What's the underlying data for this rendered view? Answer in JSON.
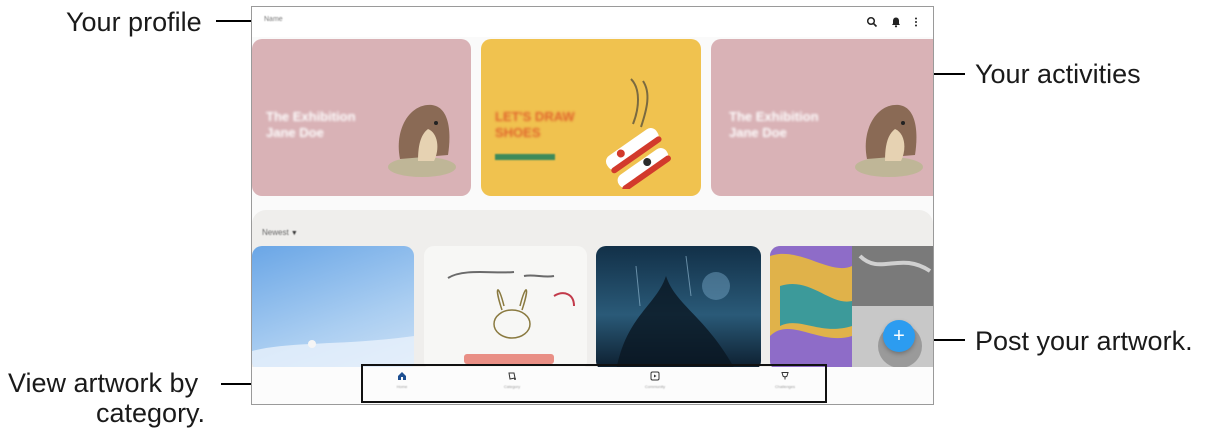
{
  "callouts": {
    "profile": "Your profile",
    "activities": "Your activities",
    "post": "Post your artwork.",
    "category_line1": "View artwork by",
    "category_line2": "category."
  },
  "app": {
    "profile_name": "Name",
    "toolbar_icons": [
      "search-icon",
      "bell-icon",
      "more-options-icon"
    ]
  },
  "banners": [
    {
      "title": "The Exhibition Jane Doe",
      "bg": "#d9b2b6"
    },
    {
      "title": "LET'S DRAW SHOES",
      "bg": "#f0c24f",
      "accent": "#e0622c"
    },
    {
      "title": "The Exhibition Jane Doe",
      "bg": "#d9b2b6"
    }
  ],
  "feed": {
    "sort_label": "Newest",
    "sort_icon": "caret-down-icon"
  },
  "fab": {
    "label": "+",
    "color": "#2c9cf0"
  },
  "bottom_nav": [
    {
      "icon": "home-icon",
      "label": "Home"
    },
    {
      "icon": "category-icon",
      "label": "Category"
    },
    {
      "icon": "community-icon",
      "label": "Community"
    },
    {
      "icon": "trophy-icon",
      "label": "Challenges"
    }
  ]
}
